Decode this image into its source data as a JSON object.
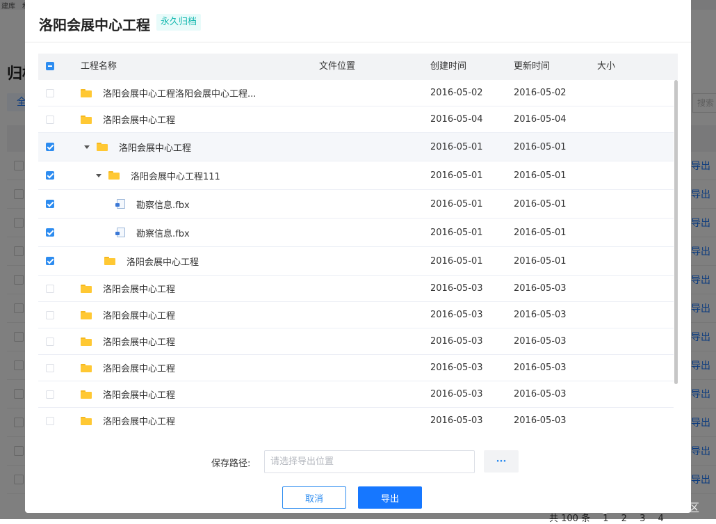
{
  "background": {
    "topbar_items": [
      "建库",
      "和"
    ],
    "title": "归档",
    "tab_label": "全",
    "search_placeholder": "搜索",
    "row_action": "导出",
    "row_count": 12,
    "footer_total": "共 100 条",
    "footer_pages": [
      "1",
      "2",
      "3",
      "4"
    ]
  },
  "modal": {
    "title": "洛阳会展中心工程",
    "badge": "永久归档",
    "table": {
      "columns": {
        "name": "工程名称",
        "location": "文件位置",
        "created": "创建时间",
        "updated": "更新时间",
        "size": "大小"
      },
      "header_checkbox": "indeterminate",
      "rows": [
        {
          "name": "洛阳会展中心工程洛阳会展中心工程...",
          "type": "folder",
          "level": 0,
          "expanded": false,
          "checked": false,
          "created": "2016-05-02",
          "updated": "2016-05-02",
          "location": "",
          "size": ""
        },
        {
          "name": "洛阳会展中心工程",
          "type": "folder",
          "level": 0,
          "expanded": false,
          "checked": false,
          "created": "2016-05-04",
          "updated": "2016-05-04",
          "location": "",
          "size": ""
        },
        {
          "name": "洛阳会展中心工程",
          "type": "folder",
          "level": 0,
          "expanded": true,
          "checked": true,
          "highlight": true,
          "created": "2016-05-01",
          "updated": "2016-05-01",
          "location": "",
          "size": ""
        },
        {
          "name": "洛阳会展中心工程111",
          "type": "folder",
          "level": 1,
          "expanded": true,
          "checked": true,
          "created": "2016-05-01",
          "updated": "2016-05-01",
          "location": "",
          "size": ""
        },
        {
          "name": "勘察信息.fbx",
          "type": "file",
          "level": 2,
          "checked": true,
          "created": "2016-05-01",
          "updated": "2016-05-01",
          "location": "",
          "size": ""
        },
        {
          "name": "勘察信息.fbx",
          "type": "file",
          "level": 2,
          "checked": true,
          "created": "2016-05-01",
          "updated": "2016-05-01",
          "location": "",
          "size": ""
        },
        {
          "name": "洛阳会展中心工程",
          "type": "folder",
          "level": 1,
          "expanded": false,
          "checked": true,
          "created": "2016-05-01",
          "updated": "2016-05-01",
          "location": "",
          "size": ""
        },
        {
          "name": "洛阳会展中心工程",
          "type": "folder",
          "level": 0,
          "expanded": false,
          "checked": false,
          "created": "2016-05-03",
          "updated": "2016-05-03",
          "location": "",
          "size": ""
        },
        {
          "name": "洛阳会展中心工程",
          "type": "folder",
          "level": 0,
          "expanded": false,
          "checked": false,
          "created": "2016-05-03",
          "updated": "2016-05-03",
          "location": "",
          "size": ""
        },
        {
          "name": "洛阳会展中心工程",
          "type": "folder",
          "level": 0,
          "expanded": false,
          "checked": false,
          "created": "2016-05-03",
          "updated": "2016-05-03",
          "location": "",
          "size": ""
        },
        {
          "name": "洛阳会展中心工程",
          "type": "folder",
          "level": 0,
          "expanded": false,
          "checked": false,
          "created": "2016-05-03",
          "updated": "2016-05-03",
          "location": "",
          "size": ""
        },
        {
          "name": "洛阳会展中心工程",
          "type": "folder",
          "level": 0,
          "expanded": false,
          "checked": false,
          "created": "2016-05-03",
          "updated": "2016-05-03",
          "location": "",
          "size": ""
        },
        {
          "name": "洛阳会展中心工程",
          "type": "folder",
          "level": 0,
          "expanded": false,
          "checked": false,
          "created": "2016-05-03",
          "updated": "2016-05-03",
          "location": "",
          "size": ""
        }
      ]
    },
    "save_path": {
      "label": "保存路径:",
      "value": "",
      "placeholder": "请选择导出位置",
      "browse_label": "···"
    },
    "buttons": {
      "cancel": "取消",
      "export": "导出"
    }
  },
  "watermark": "@稀土掘金技术社区",
  "colors": {
    "primary": "#1677ff",
    "checkbox": "#2d8cf0",
    "folder": "#ffc833",
    "badge_bg": "#e8fbfa",
    "badge_text": "#18b9b0"
  }
}
